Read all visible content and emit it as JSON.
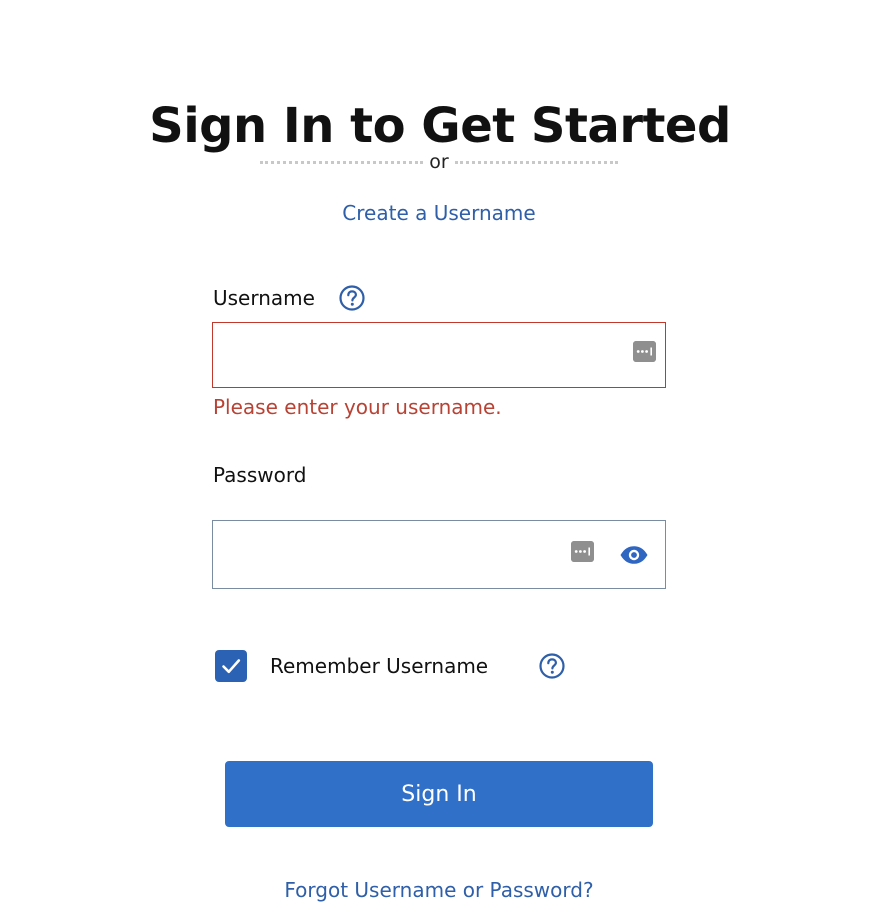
{
  "header": {
    "title": "Sign In to Get Started",
    "divider_text": "or",
    "create_username_link": "Create a Username"
  },
  "form": {
    "username": {
      "label": "Username",
      "value": "",
      "error": "Please enter your username."
    },
    "password": {
      "label": "Password",
      "value": ""
    },
    "remember": {
      "label": "Remember Username",
      "checked": true
    },
    "submit_label": "Sign In",
    "forgot_link": "Forgot Username or Password?"
  },
  "icons": {
    "help": "help-circle-icon",
    "password_manager": "password-manager-key-icon",
    "show_password": "eye-icon",
    "check": "check-icon"
  },
  "colors": {
    "link": "#2e5fa8",
    "error": "#b84234",
    "error_border": "#c0392b",
    "primary_button": "#3170c8",
    "checkbox": "#2c62b3"
  }
}
